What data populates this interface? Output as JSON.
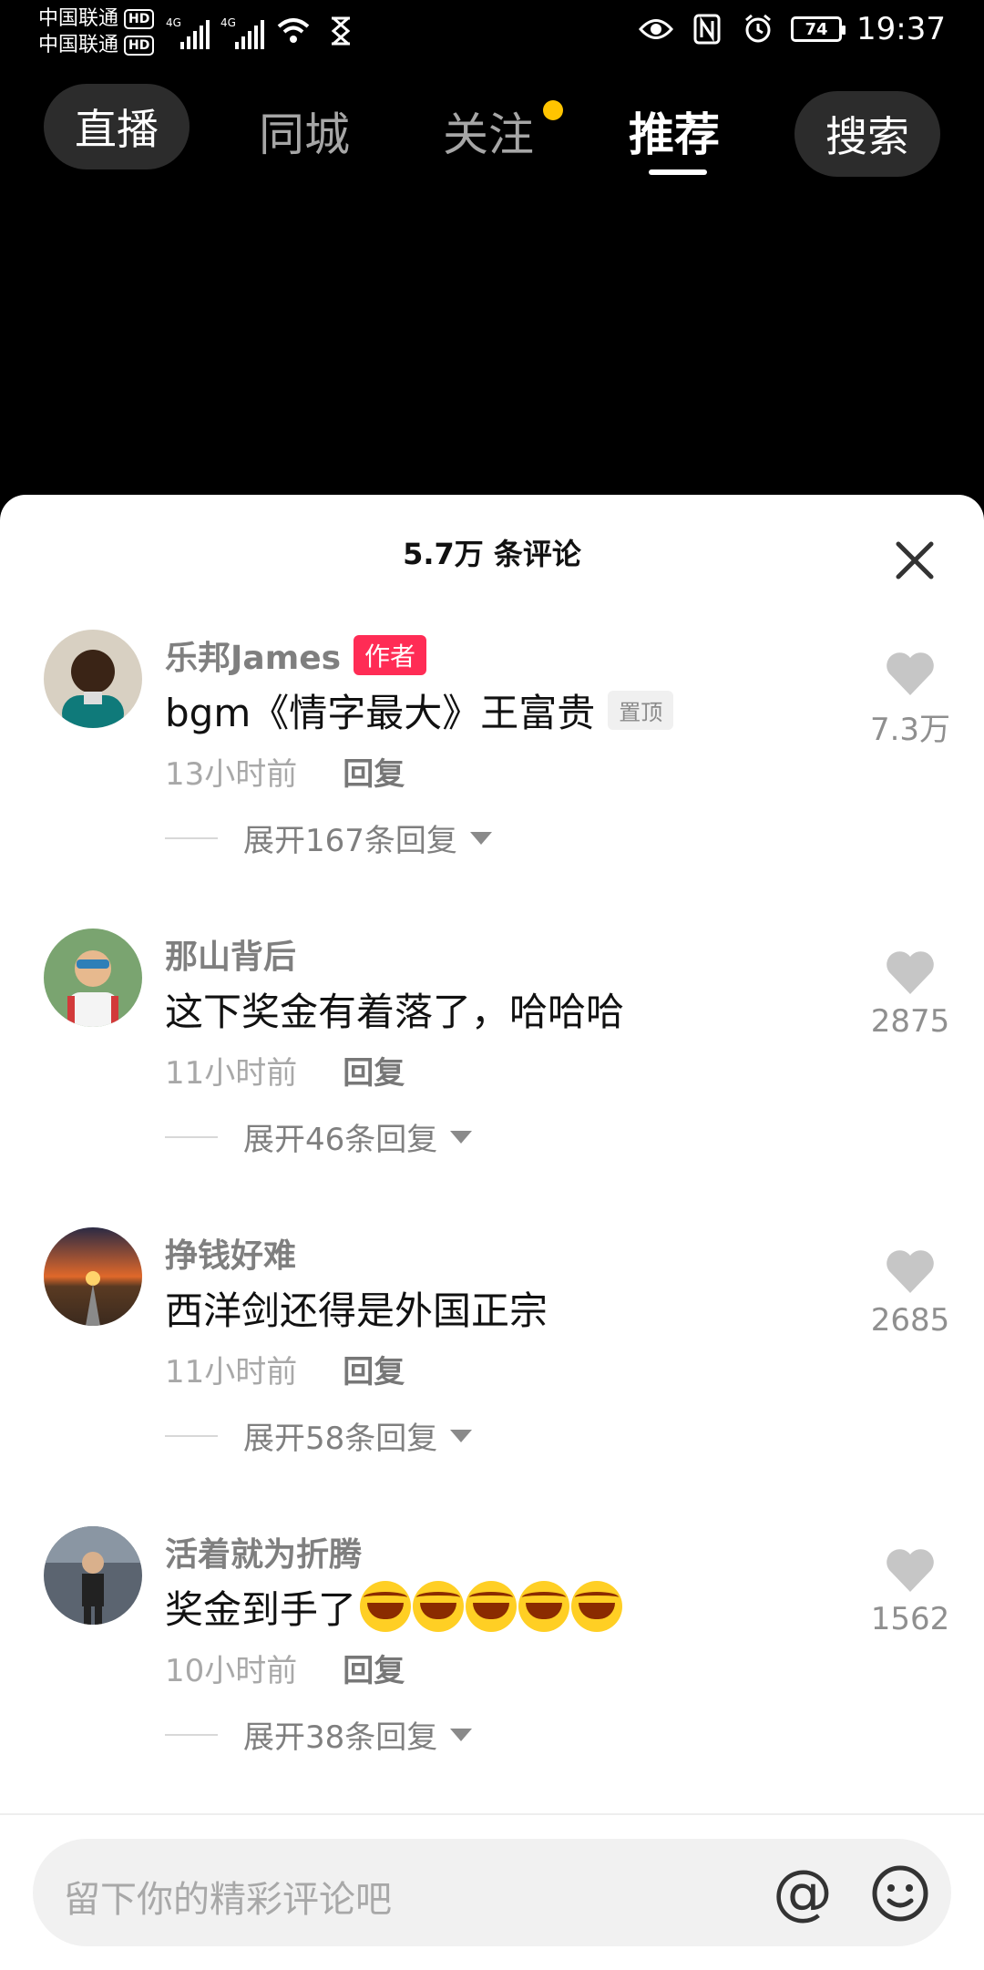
{
  "status_bar": {
    "carrier_1": "中国联通",
    "carrier_2": "中国联通",
    "hd": "HD",
    "network_1": "4G",
    "network_2": "4G",
    "battery": "74",
    "time": "19:37"
  },
  "top_nav": {
    "live": "直播",
    "city": "同城",
    "follow": "关注",
    "recommend": "推荐",
    "search": "搜索"
  },
  "panel": {
    "title": "5.7万 条评论"
  },
  "comments": [
    {
      "name": "乐邦James",
      "author_badge": "作者",
      "text": "bgm《情字最大》王富贵",
      "pin_badge": "置顶",
      "time": "13小时前",
      "reply": "回复",
      "expand": "展开167条回复",
      "likes": "7.3万"
    },
    {
      "name": "那山背后",
      "text": "这下奖金有着落了，哈哈哈",
      "time": "11小时前",
      "reply": "回复",
      "expand": "展开46条回复",
      "likes": "2875"
    },
    {
      "name": "挣钱好难",
      "text": "西洋剑还得是外国正宗",
      "time": "11小时前",
      "reply": "回复",
      "expand": "展开58条回复",
      "likes": "2685"
    },
    {
      "name": "活着就为折腾",
      "text": "奖金到手了",
      "time": "10小时前",
      "reply": "回复",
      "expand": "展开38条回复",
      "likes": "1562"
    }
  ],
  "input": {
    "placeholder": "留下你的精彩评论吧",
    "at": "@"
  },
  "colors": {
    "author_badge": "#ff2c55",
    "follow_dot": "#ffc400"
  }
}
